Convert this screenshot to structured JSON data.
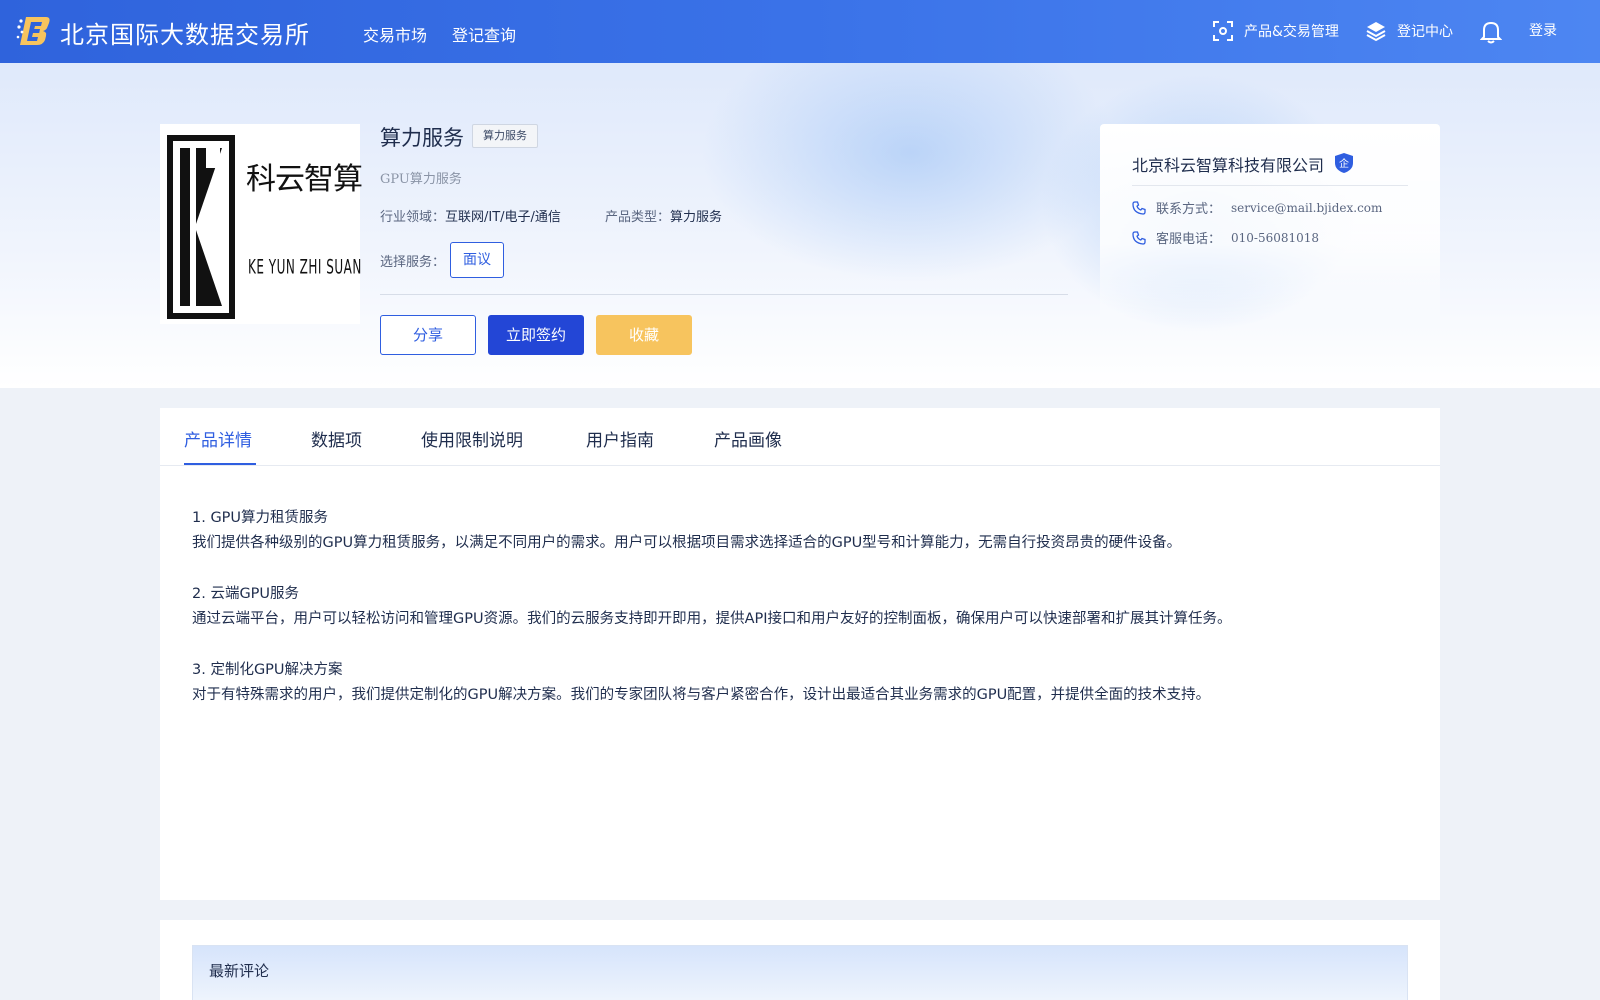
{
  "colors": {
    "primary": "#2346d6",
    "accent_blue": "#2f5ee0",
    "favorite_yellow": "#f7c45e",
    "header_gradient_start": "#2f63dc",
    "header_gradient_end": "#4d86f2"
  },
  "header": {
    "logo_icon": "bjidex-logo",
    "brand": "北京国际大数据交易所",
    "nav": [
      "交易市场",
      "登记查询"
    ],
    "right": {
      "product_trade_mgmt": "产品&交易管理",
      "registration_center": "登记中心",
      "notification_icon": "bell-icon",
      "login": "登录"
    }
  },
  "product": {
    "logo_text": "科云智算",
    "logo_subtext": "KE YUN ZHI SUAN",
    "title": "算力服务",
    "tag": "算力服务",
    "subtitle": "GPU算力服务",
    "industry_label": "行业领域：",
    "industry_value": "互联网/IT/电子/通信",
    "type_label": "产品类型：",
    "type_value": "算力服务",
    "select_service_label": "选择服务：",
    "service_option": "面议",
    "buttons": {
      "share": "分享",
      "sign": "立即签约",
      "favorite": "收藏"
    }
  },
  "company": {
    "name": "北京科云智算科技有限公司",
    "badge": "企",
    "contact_label": "联系方式：",
    "contact_value": "service@mail.bjidex.com",
    "phone_label": "客服电话：",
    "phone_value": "010-56081018"
  },
  "tabs": [
    "产品详情",
    "数据项",
    "使用限制说明",
    "用户指南",
    "产品画像"
  ],
  "active_tab": 0,
  "details": [
    {
      "heading": "1. GPU算力租赁服务",
      "body": "我们提供各种级别的GPU算力租赁服务，以满足不同用户的需求。用户可以根据项目需求选择适合的GPU型号和计算能力，无需自行投资昂贵的硬件设备。"
    },
    {
      "heading": "2. 云端GPU服务",
      "body": "通过云端平台，用户可以轻松访问和管理GPU资源。我们的云服务支持即开即用，提供API接口和用户友好的控制面板，确保用户可以快速部署和扩展其计算任务。"
    },
    {
      "heading": "3. 定制化GPU解决方案",
      "body": "对于有特殊需求的用户，我们提供定制化的GPU解决方案。我们的专家团队将与客户紧密合作，设计出最适合其业务需求的GPU配置，并提供全面的技术支持。"
    }
  ],
  "comments": {
    "title": "最新评论"
  }
}
